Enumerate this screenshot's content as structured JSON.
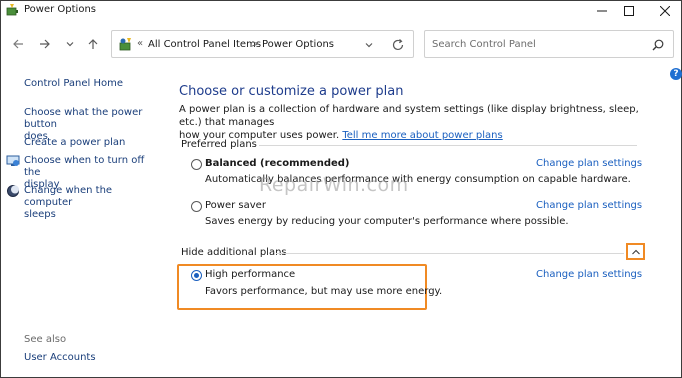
{
  "window": {
    "title": "Power Options"
  },
  "address": {
    "sep": "«",
    "crumbs": [
      "All Control Panel Items",
      "Power Options"
    ],
    "crumb_sep": ">"
  },
  "search": {
    "placeholder": "Search Control Panel"
  },
  "left_pane": {
    "home": "Control Panel Home",
    "links": [
      {
        "label_line1": "Choose what the power button",
        "label_line2": "does"
      },
      {
        "label_line1": "Create a power plan",
        "label_line2": ""
      },
      {
        "label_line1": "Choose when to turn off the",
        "label_line2": "display"
      },
      {
        "label_line1": "Change when the computer",
        "label_line2": "sleeps"
      }
    ],
    "see_also": "See also",
    "user_accounts": "User Accounts"
  },
  "main": {
    "heading": "Choose or customize a power plan",
    "intro_line1": "A power plan is a collection of hardware and system settings (like display brightness, sleep, etc.) that manages",
    "intro_line2": "how your computer uses power.",
    "intro_link": "Tell me more about power plans",
    "preferred_title": "Preferred plans",
    "hide_title": "Hide additional plans",
    "plans": [
      {
        "name": "Balanced (recommended)",
        "desc": "Automatically balances performance with energy consumption on capable hardware.",
        "link": "Change plan settings",
        "selected": false
      },
      {
        "name": "Power saver",
        "desc": "Saves energy by reducing your computer's performance where possible.",
        "link": "Change plan settings",
        "selected": false
      },
      {
        "name": "High performance",
        "desc": "Favors performance, but may use more energy.",
        "link": "Change plan settings",
        "selected": true
      }
    ]
  },
  "watermark": "RepairWin.com",
  "help": "?"
}
